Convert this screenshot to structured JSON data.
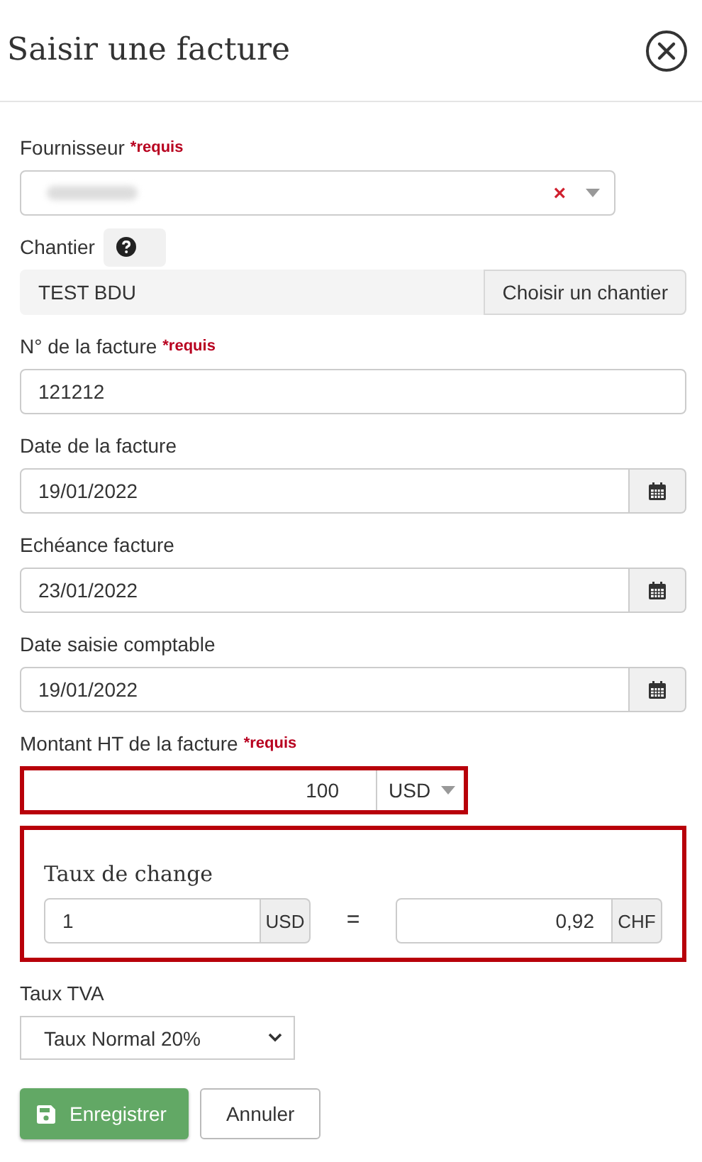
{
  "dialog": {
    "title": "Saisir une facture"
  },
  "fields": [
    {
      "kind": "select",
      "label": "Fournisseur",
      "required_mark": "*requis",
      "value_blurred": true,
      "clear": "×"
    },
    {
      "kind": "picker",
      "label": "Chantier",
      "help": true,
      "value": "TEST BDU",
      "button": "Choisir un chantier"
    },
    {
      "kind": "text",
      "label": "N° de la facture",
      "required_mark": "*requis",
      "value": "121212"
    },
    {
      "kind": "date",
      "label": "Date de la facture",
      "value": "19/01/2022"
    },
    {
      "kind": "date",
      "label": "Echéance facture",
      "value": "23/01/2022"
    },
    {
      "kind": "date",
      "label": "Date saisie comptable",
      "value": "19/01/2022"
    },
    {
      "kind": "amount",
      "label": "Montant HT de la facture",
      "required_mark": "*requis",
      "value": "100",
      "currency": "USD",
      "highlighted": true
    }
  ],
  "exchange": {
    "title": "Taux de change",
    "highlighted": true,
    "from_value": "1",
    "from_currency": "USD",
    "equals": "=",
    "to_value": "0,92",
    "to_currency": "CHF"
  },
  "vat": {
    "label": "Taux TVA",
    "value": "Taux Normal 20%"
  },
  "buttons": [
    {
      "kind": "primary",
      "label": "Enregistrer"
    },
    {
      "kind": "default",
      "label": "Annuler"
    }
  ]
}
